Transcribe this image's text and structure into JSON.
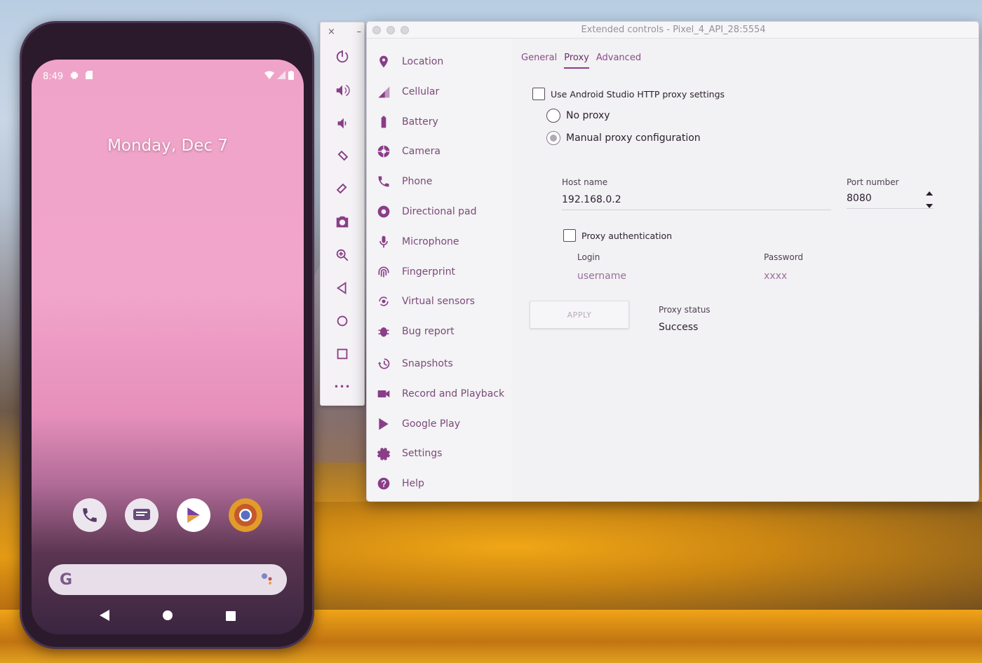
{
  "phone": {
    "time": "8:49",
    "date": "Monday, Dec 7",
    "dock_apps": [
      "phone-icon",
      "messages-icon",
      "play-store-icon",
      "chrome-icon"
    ],
    "search_logo": "G"
  },
  "toolbar": {
    "close": "×",
    "minimize": "–",
    "more": "•••"
  },
  "window": {
    "title": "Extended controls - Pixel_4_API_28:5554"
  },
  "sidebar": {
    "items": [
      {
        "label": "Location",
        "icon": "location-pin-icon"
      },
      {
        "label": "Cellular",
        "icon": "cellular-signal-icon"
      },
      {
        "label": "Battery",
        "icon": "battery-icon"
      },
      {
        "label": "Camera",
        "icon": "camera-aperture-icon"
      },
      {
        "label": "Phone",
        "icon": "phone-icon"
      },
      {
        "label": "Directional pad",
        "icon": "dpad-icon"
      },
      {
        "label": "Microphone",
        "icon": "microphone-icon"
      },
      {
        "label": "Fingerprint",
        "icon": "fingerprint-icon"
      },
      {
        "label": "Virtual sensors",
        "icon": "sensors-icon"
      },
      {
        "label": "Bug report",
        "icon": "bug-icon"
      },
      {
        "label": "Snapshots",
        "icon": "history-icon"
      },
      {
        "label": "Record and Playback",
        "icon": "video-camera-icon"
      },
      {
        "label": "Google Play",
        "icon": "play-icon"
      },
      {
        "label": "Settings",
        "icon": "gear-icon"
      },
      {
        "label": "Help",
        "icon": "help-icon"
      }
    ]
  },
  "tabs": [
    {
      "label": "General",
      "active": false
    },
    {
      "label": "Proxy",
      "active": true
    },
    {
      "label": "Advanced",
      "active": false
    }
  ],
  "proxy": {
    "use_studio_label": "Use Android Studio HTTP proxy settings",
    "no_proxy_label": "No proxy",
    "manual_label": "Manual proxy configuration",
    "host_label": "Host name",
    "host_value": "192.168.0.2",
    "port_label": "Port number",
    "port_value": "8080",
    "auth_label": "Proxy authentication",
    "login_label": "Login",
    "login_value": "username",
    "password_label": "Password",
    "password_value": "xxxx",
    "apply_label": "APPLY",
    "status_label": "Proxy status",
    "status_value": "Success"
  },
  "colors": {
    "accent": "#8a3d88",
    "phone_wallpaper": "#f2a5cb"
  }
}
